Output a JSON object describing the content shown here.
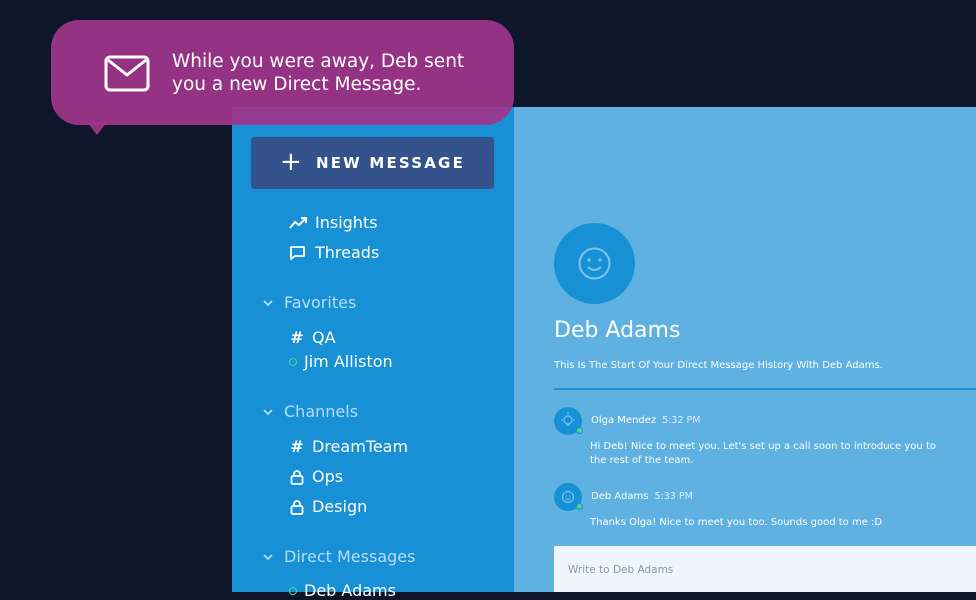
{
  "notification": {
    "line1": "While you were away, Deb sent",
    "line2": "you a new Direct Message.",
    "icon": "mail-icon"
  },
  "sidebar": {
    "new_message": "NEW MESSAGE",
    "nav": [
      {
        "label": "Insights",
        "icon": "trending-up-icon"
      },
      {
        "label": "Threads",
        "icon": "chat-bubble-icon"
      }
    ],
    "sections": [
      {
        "label": "Favorites",
        "items": [
          {
            "label": "QA",
            "icon": "hash-icon"
          },
          {
            "label": "Jim Alliston",
            "icon": "online-status-icon"
          }
        ]
      },
      {
        "label": "Channels",
        "items": [
          {
            "label": "DreamTeam",
            "icon": "hash-icon"
          },
          {
            "label": "Ops",
            "icon": "lock-icon"
          },
          {
            "label": "Design",
            "icon": "lock-icon"
          }
        ]
      },
      {
        "label": "Direct Messages",
        "items": [
          {
            "label": "Deb Adams",
            "icon": "online-status-icon"
          }
        ]
      }
    ]
  },
  "chat": {
    "name": "Deb Adams",
    "intro": "This Is The Start Of Your Direct Message History With Deb Adams.",
    "messages": [
      {
        "author": "Olga Mendez",
        "time": "5:32 PM",
        "line1": "Hi Deb! Nice to meet you. Let's set up a call soon to introduce you to",
        "line2": "the rest of the team."
      },
      {
        "author": "Deb Adams",
        "time": "5:33 PM",
        "line1": "Thanks Olga! Nice to meet you too. Sounds good to me :D"
      }
    ],
    "composer_placeholder": "Write to Deb Adams"
  },
  "colors": {
    "background": "#0e1629",
    "sidebar": "#1790d6",
    "main": "#5eb1e0",
    "button": "#34538c",
    "notification": "#a0358c",
    "online": "#51d88a"
  }
}
